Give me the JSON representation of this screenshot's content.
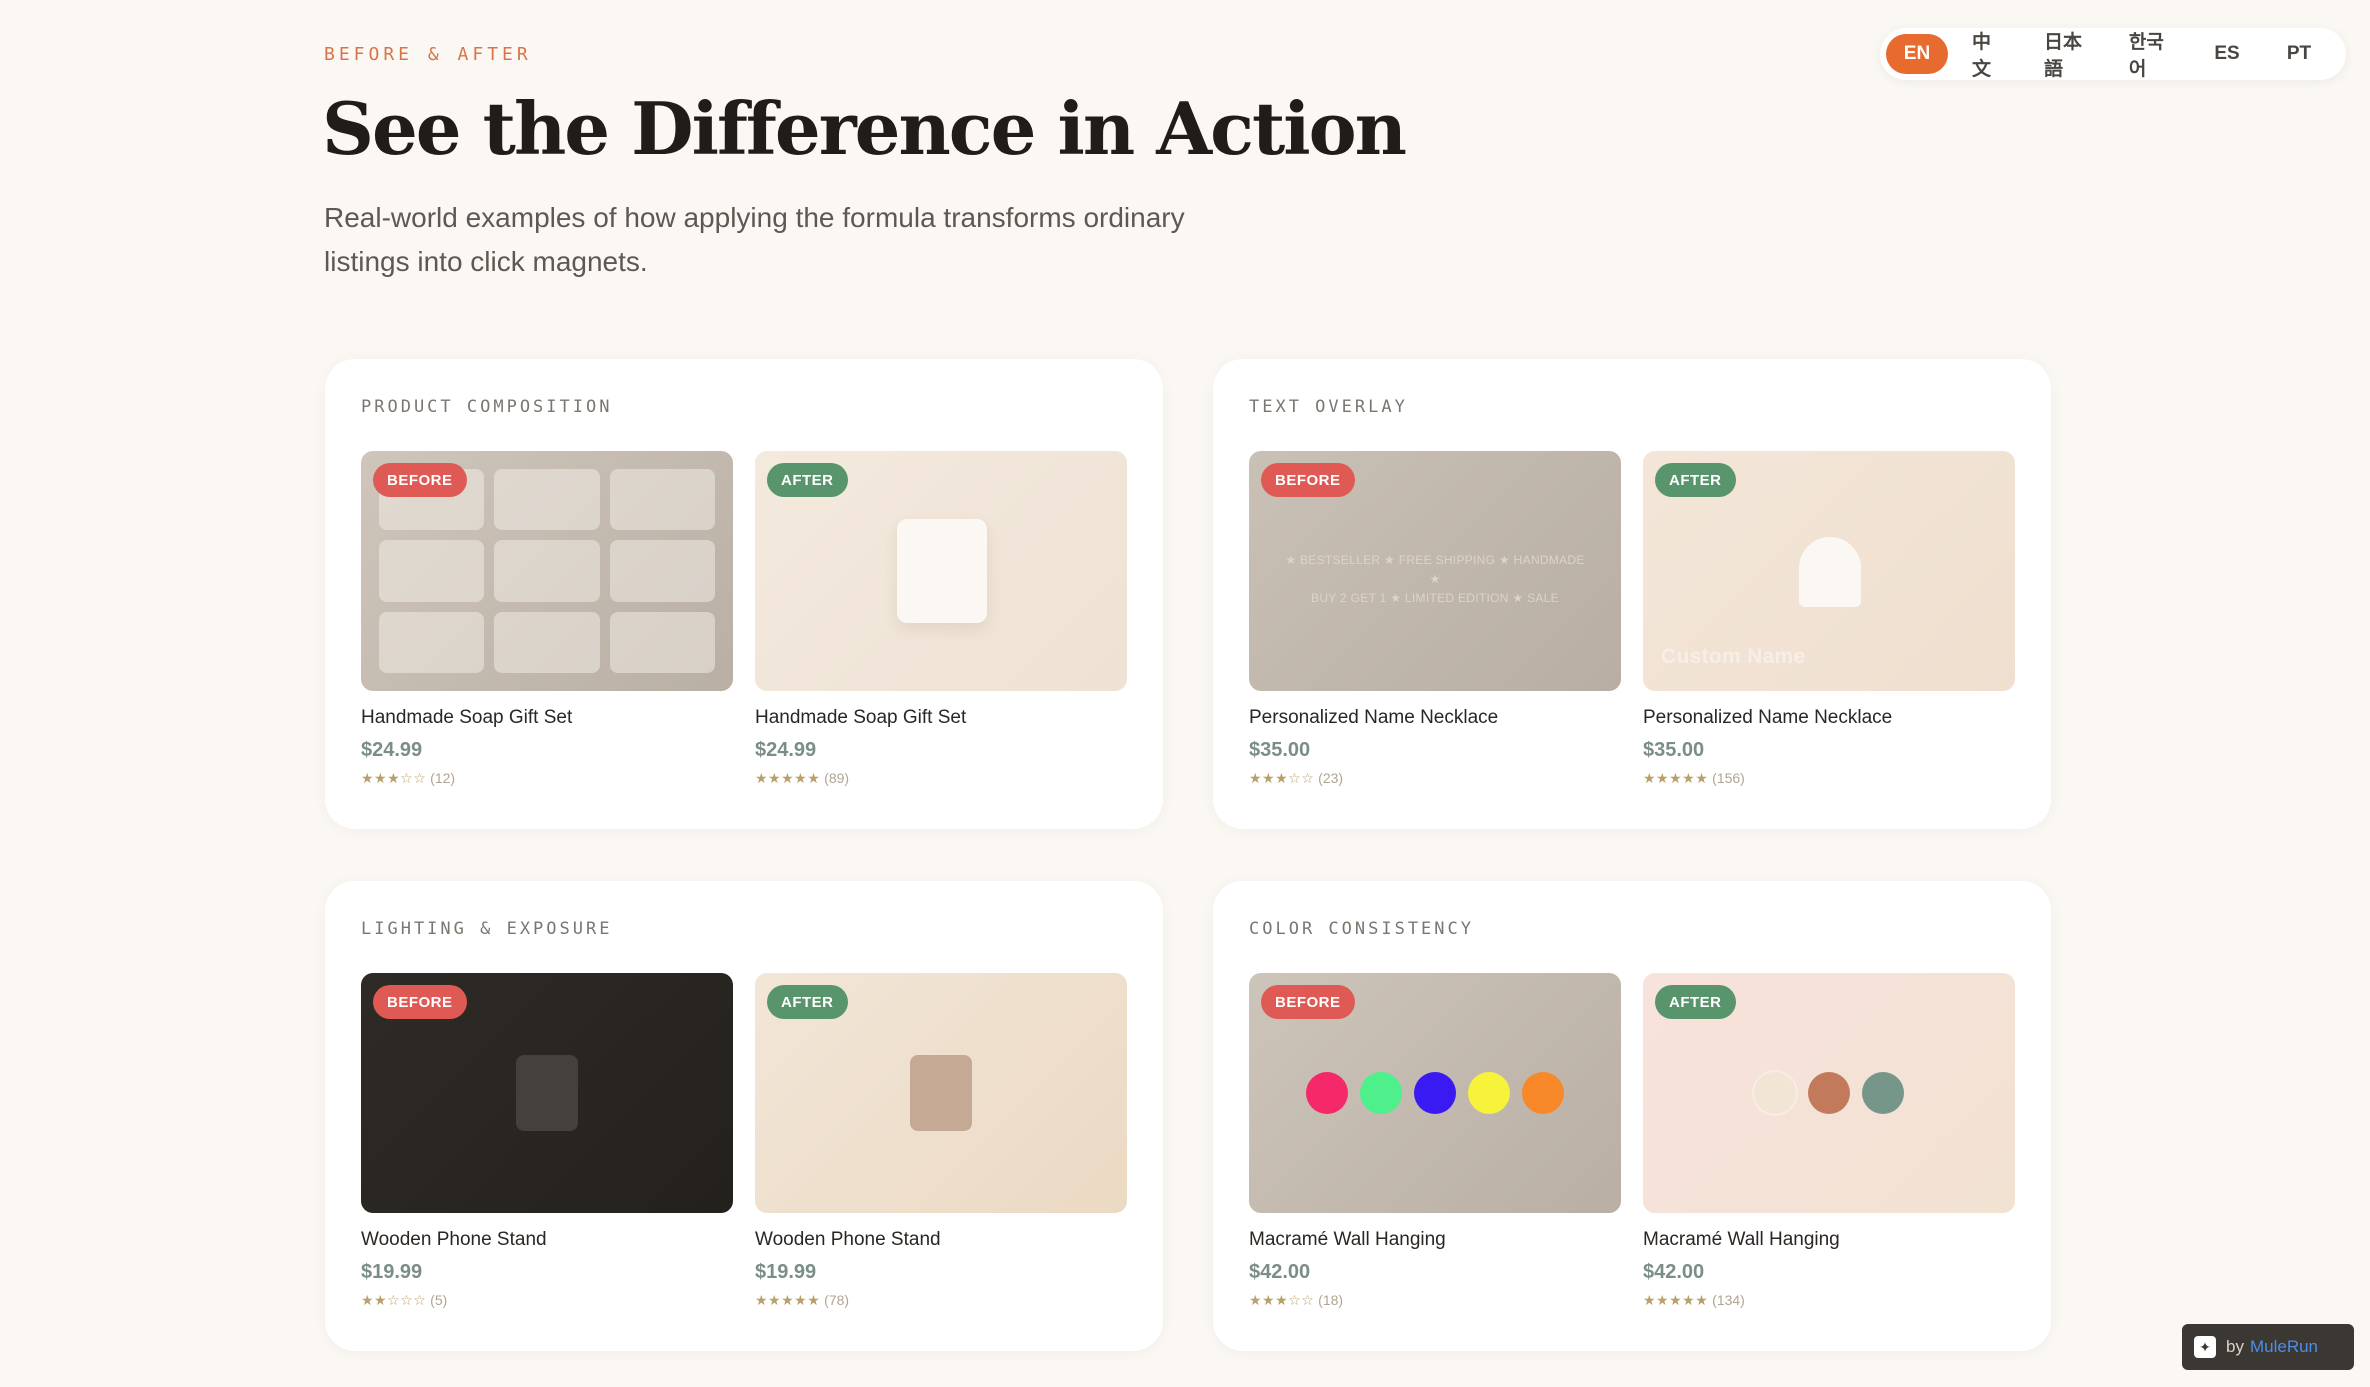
{
  "languages": [
    {
      "label": "EN",
      "active": true
    },
    {
      "label": "中文",
      "active": false
    },
    {
      "label": "日本語",
      "active": false
    },
    {
      "label": "한국어",
      "active": false
    },
    {
      "label": "ES",
      "active": false
    },
    {
      "label": "PT",
      "active": false
    }
  ],
  "header": {
    "eyebrow": "BEFORE & AFTER",
    "title": "See the Difference in Action",
    "subtitle_line1": "Real-world examples of how applying the formula transforms ordinary",
    "subtitle_line2": "listings into click magnets."
  },
  "badges": {
    "before": "BEFORE",
    "after": "AFTER"
  },
  "cards": [
    {
      "label": "PRODUCT COMPOSITION",
      "before": {
        "name": "Handmade Soap Gift Set",
        "price": "$24.99",
        "stars": "★★★☆☆",
        "reviews": "(12)"
      },
      "after": {
        "name": "Handmade Soap Gift Set",
        "price": "$24.99",
        "stars": "★★★★★",
        "reviews": "(89)"
      }
    },
    {
      "label": "TEXT OVERLAY",
      "before": {
        "name": "Personalized Name Necklace",
        "price": "$35.00",
        "stars": "★★★☆☆",
        "reviews": "(23)",
        "noise_line1": "★ BESTSELLER ★ FREE SHIPPING ★ HANDMADE ★",
        "noise_line2": "BUY 2 GET 1 ★ LIMITED EDITION ★ SALE"
      },
      "after": {
        "name": "Personalized Name Necklace",
        "price": "$35.00",
        "stars": "★★★★★",
        "reviews": "(156)",
        "overlay": "Custom Name"
      }
    },
    {
      "label": "LIGHTING & EXPOSURE",
      "before": {
        "name": "Wooden Phone Stand",
        "price": "$19.99",
        "stars": "★★☆☆☆",
        "reviews": "(5)"
      },
      "after": {
        "name": "Wooden Phone Stand",
        "price": "$19.99",
        "stars": "★★★★★",
        "reviews": "(78)"
      }
    },
    {
      "label": "COLOR CONSISTENCY",
      "before": {
        "name": "Macramé Wall Hanging",
        "price": "$42.00",
        "stars": "★★★☆☆",
        "reviews": "(18)"
      },
      "after": {
        "name": "Macramé Wall Hanging",
        "price": "$42.00",
        "stars": "★★★★★",
        "reviews": "(134)"
      }
    }
  ],
  "colors": {
    "accent": "#e76a2f",
    "before_badge": "#df5a55",
    "after_badge": "#58946c",
    "before_swatches": [
      "#f5286a",
      "#4df08a",
      "#3a1af2",
      "#f7f23a",
      "#f7892a"
    ],
    "after_swatches": [
      "#f1e6d6",
      "#c27a5c",
      "#77968a"
    ]
  },
  "watermark": {
    "by": "by",
    "brand": "MuleRun"
  }
}
